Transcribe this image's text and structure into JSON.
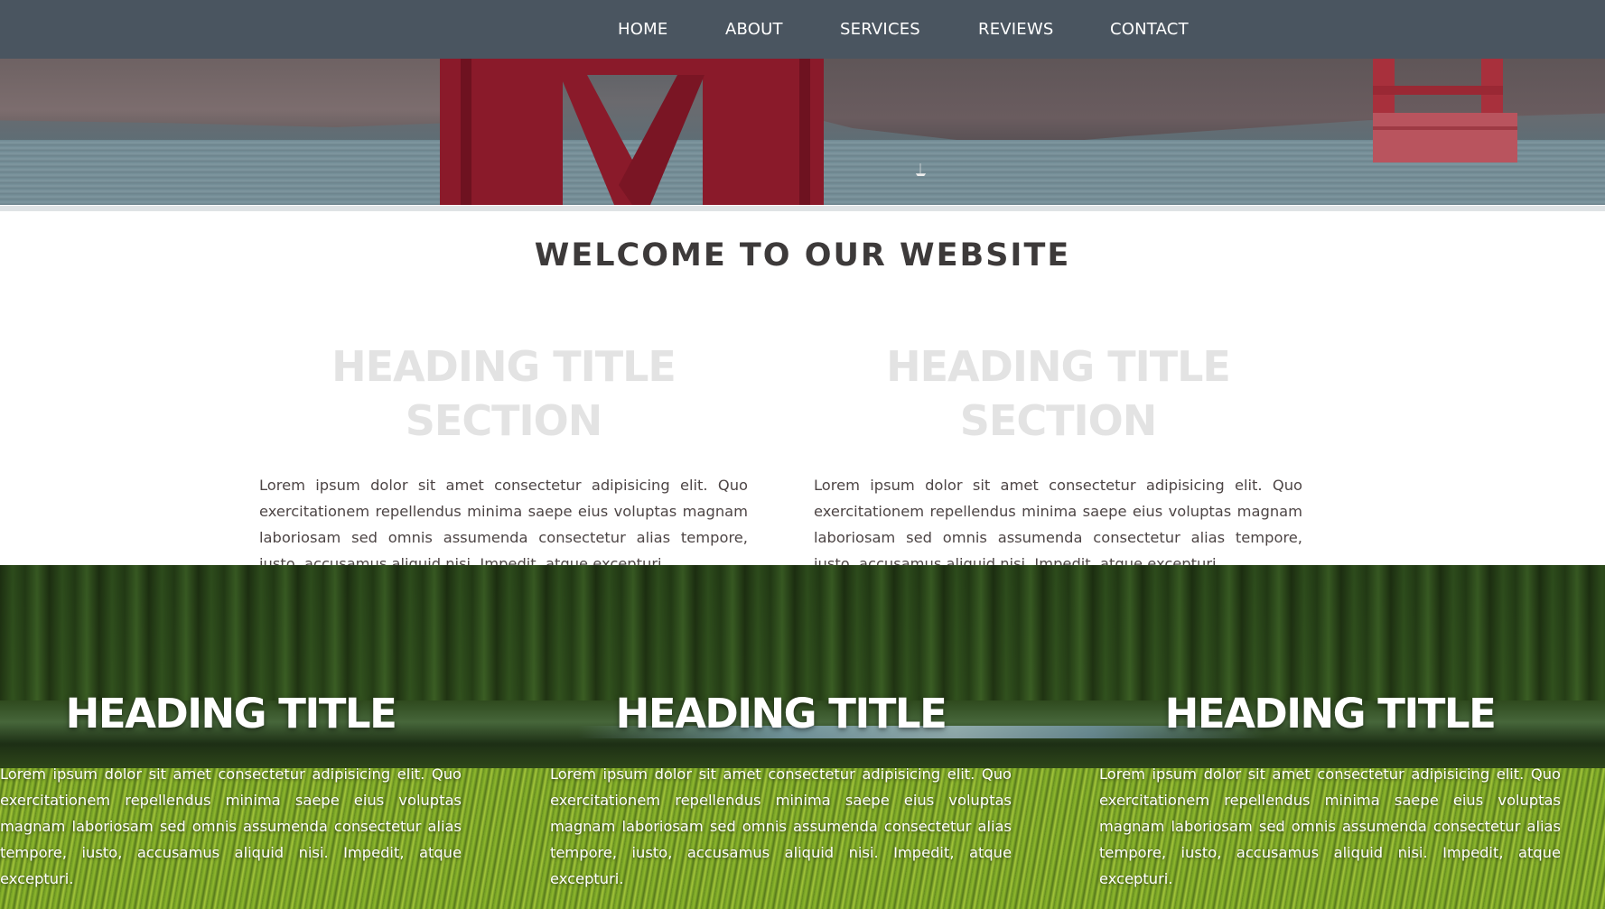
{
  "nav": {
    "items": [
      "HOME",
      "ABOUT",
      "SERVICES",
      "REVIEWS",
      "CONTACT"
    ]
  },
  "welcome": {
    "title": "WELCOME TO OUR WEBSITE"
  },
  "sections": [
    {
      "heading": "HEADING TITLE SECTION",
      "body": "Lorem ipsum dolor sit amet consectetur adipisicing elit. Quo exercitationem repellendus minima saepe eius voluptas magnam laboriosam sed omnis assumenda consectetur alias tempore, iusto, accusamus aliquid nisi. Impedit, atque excepturi."
    },
    {
      "heading": "HEADING TITLE SECTION",
      "body": "Lorem ipsum dolor sit amet consectetur adipisicing elit. Quo exercitationem repellendus minima saepe eius voluptas magnam laboriosam sed omnis assumenda consectetur alias tempore, iusto, accusamus aliquid nisi. Impedit, atque excepturi."
    }
  ],
  "features": [
    {
      "heading": "HEADING TITLE",
      "body": "Lorem ipsum dolor sit amet consectetur adipisicing elit. Quo exercitationem repellendus minima saepe eius voluptas magnam laboriosam sed omnis assumenda consectetur alias tempore, iusto, accusamus aliquid nisi. Impedit, atque excepturi."
    },
    {
      "heading": "HEADING TITLE",
      "body": "Lorem ipsum dolor sit amet consectetur adipisicing elit. Quo exercitationem repellendus minima saepe eius voluptas magnam laboriosam sed omnis assumenda consectetur alias tempore, iusto, accusamus aliquid nisi. Impedit, atque excepturi."
    },
    {
      "heading": "HEADING TITLE",
      "body": "Lorem ipsum dolor sit amet consectetur adipisicing elit. Quo exercitationem repellendus minima saepe eius voluptas magnam laboriosam sed omnis assumenda consectetur alias tempore, iusto, accusamus aliquid nisi. Impedit, atque excepturi."
    }
  ],
  "colors": {
    "nav_bg": "#4a5560",
    "welcome_text": "#3d3a3a",
    "section_heading": "#e3e3e3",
    "body_text": "#4d4545"
  }
}
